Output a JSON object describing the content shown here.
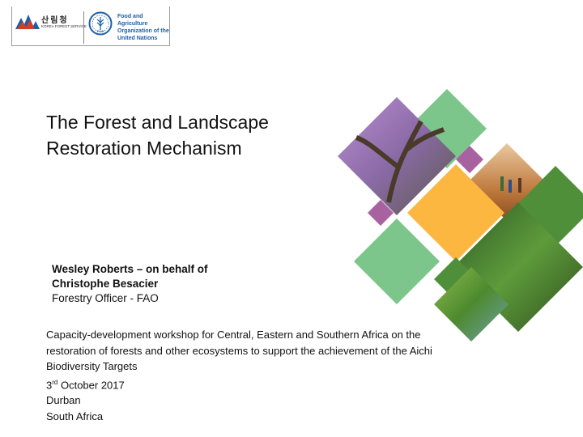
{
  "logos": {
    "kfs": {
      "korean": "산림청",
      "english": "KOREA FOREST SERVICE"
    },
    "fao": {
      "lines": [
        "Food and Agriculture",
        "Organization of the",
        "United Nations"
      ]
    }
  },
  "title": {
    "line1": "The Forest and Landscape",
    "line2": "Restoration Mechanism"
  },
  "presenter": {
    "line1": "Wesley Roberts – on behalf of",
    "line2": "Christophe Besacier",
    "line3": "Forestry Officer - FAO"
  },
  "event": {
    "line1": "Capacity-development workshop for Central, Eastern and Southern Africa on the",
    "line2": "restoration of forests and other ecosystems to support the achievement of the Aichi",
    "line3": "Biodiversity Targets",
    "date_day": "3",
    "date_suffix": "rd",
    "date_rest": " October 2017",
    "city": "Durban",
    "country": "South Africa"
  },
  "colors": {
    "green_light": "#7cc68c",
    "green_dark": "#4f8f3a",
    "yellow": "#fbb740",
    "purple": "#a8629f",
    "fao_blue": "#1d5fa8"
  }
}
